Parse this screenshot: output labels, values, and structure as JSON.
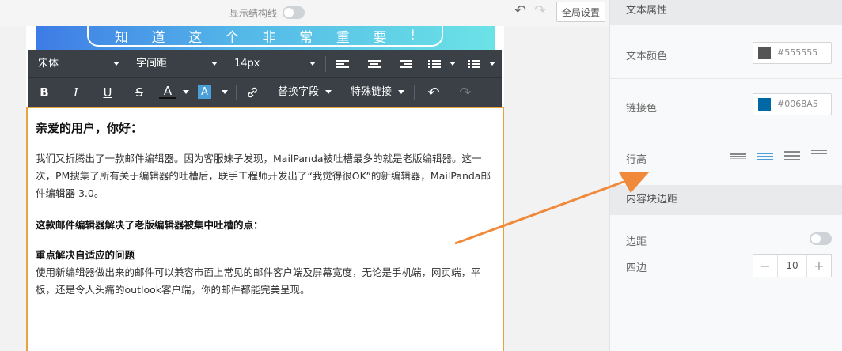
{
  "canvas": {
    "structure_label": "显示结构线",
    "global_settings_label": "全局设置",
    "banner_chars": [
      "知",
      "道",
      "这",
      "个",
      "非",
      "常",
      "重",
      "要",
      "!"
    ]
  },
  "toolbar": {
    "font_family": "宋体",
    "letter_spacing": "字间距",
    "font_size": "14px",
    "bold": "B",
    "italic": "I",
    "underline": "U",
    "strike": "S",
    "font_color": "A",
    "bg_color": "A",
    "replace_field": "替换字段",
    "special_link": "特殊链接"
  },
  "content": {
    "greeting": "亲爱的用户，你好：",
    "para1": "我们又折腾出了一款邮件编辑器。因为客服妹子发现，MailPanda被吐槽最多的就是老版编辑器。这一次，PM搜集了所有关于编辑器的吐槽后，联手工程师开发出了“我觉得很OK”的新编辑器，MailPanda邮件编辑器 3.0。",
    "bold_line": "这款邮件编辑器解决了老版编辑器被集中吐槽的点：",
    "sub_title": "重点解决自适应的问题",
    "para2": "使用新编辑器做出来的邮件可以兼容市面上常见的邮件客户端及屏幕宽度，无论是手机端，网页端，平板，还是令人头痛的outlook客户端，你的邮件都能完美呈现。"
  },
  "panel": {
    "text_props_title": "文本属性",
    "text_color_label": "文本颜色",
    "text_color_value": "#555555",
    "link_color_label": "链接色",
    "link_color_value": "#0068A5",
    "line_height_label": "行高",
    "block_padding_title": "内容块边距",
    "padding_label": "边距",
    "four_sides_label": "四边",
    "four_sides_value": "10",
    "minus": "−",
    "plus": "+"
  },
  "colors": {
    "accent": "#e6a33e",
    "arrow": "#f08a3a",
    "toolbar_bg": "#3b4047",
    "link_color": "#0068A5",
    "text_color": "#555555",
    "line_height_selected": "#4a9fd8"
  }
}
